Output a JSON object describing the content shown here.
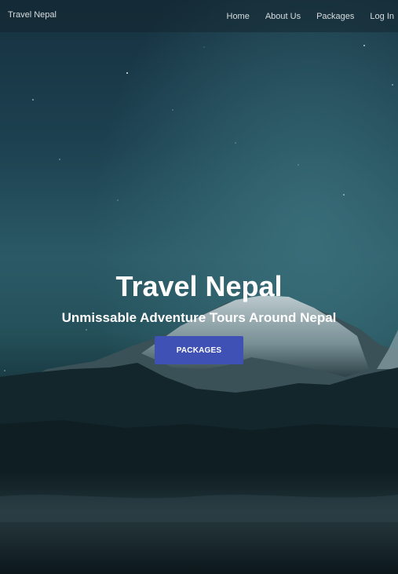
{
  "navbar": {
    "brand": "Travel Nepal",
    "links": [
      "Home",
      "About Us",
      "Packages",
      "Log In"
    ]
  },
  "hero": {
    "title": "Travel Nepal",
    "subtitle": "Unmissable Adventure Tours Around Nepal",
    "button_label": "PACKAGES"
  },
  "colors": {
    "button": "#3f51b5",
    "sky_top": "#163140",
    "sky_mid": "#2b5a66",
    "ground": "#0a171c"
  },
  "background": {
    "icon": "mountain-night-sky-image"
  }
}
